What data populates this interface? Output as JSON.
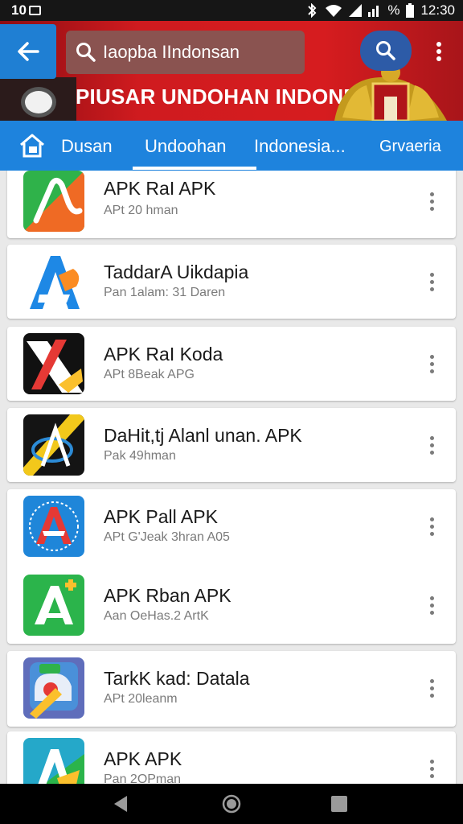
{
  "status_bar": {
    "left": "10",
    "battery_percent": "%",
    "time": "12:30"
  },
  "header": {
    "search_placeholder": "Iaopba IIndonsan",
    "banner_title": "PIUSAR UNDOHAN INDONESÍA",
    "accent_color": "#1e83dd",
    "banner_color": "#d61c1f"
  },
  "tabs": [
    {
      "label": "Dusan"
    },
    {
      "label": "Undoohan",
      "selected": true
    },
    {
      "label": "Indonesia..."
    },
    {
      "label": "Grvaeria"
    }
  ],
  "apps": [
    {
      "title": "APK RaI APK",
      "subtitle": "APt 20 hman",
      "icon": "green-orange-a-icon"
    },
    {
      "title": "TaddarA Uikdapia",
      "subtitle": "Pan 1alam: 31 Daren",
      "icon": "blue-a-icon"
    },
    {
      "title": "APK RaI Koda",
      "subtitle": "APt 8Beak APG",
      "icon": "red-black-x-icon"
    },
    {
      "title": "DaHit,tj Alanl unan. APK",
      "subtitle": "Pak 49hman",
      "icon": "black-yellow-a-icon"
    },
    {
      "title": "APK Pall APK",
      "subtitle": "APt G'Jeak 3hran A05",
      "icon": "blue-red-a-badge-icon"
    },
    {
      "title": "APK Rban APK",
      "subtitle": "Aan OeHas.2 ArtK",
      "icon": "green-a-icon"
    },
    {
      "title": "TarkK kad: Datala",
      "subtitle": "APt 20leanm",
      "icon": "cloud-brush-icon"
    },
    {
      "title": "APK APK",
      "subtitle": "Pan 2OPman",
      "icon": "teal-yellow-a-icon"
    }
  ]
}
